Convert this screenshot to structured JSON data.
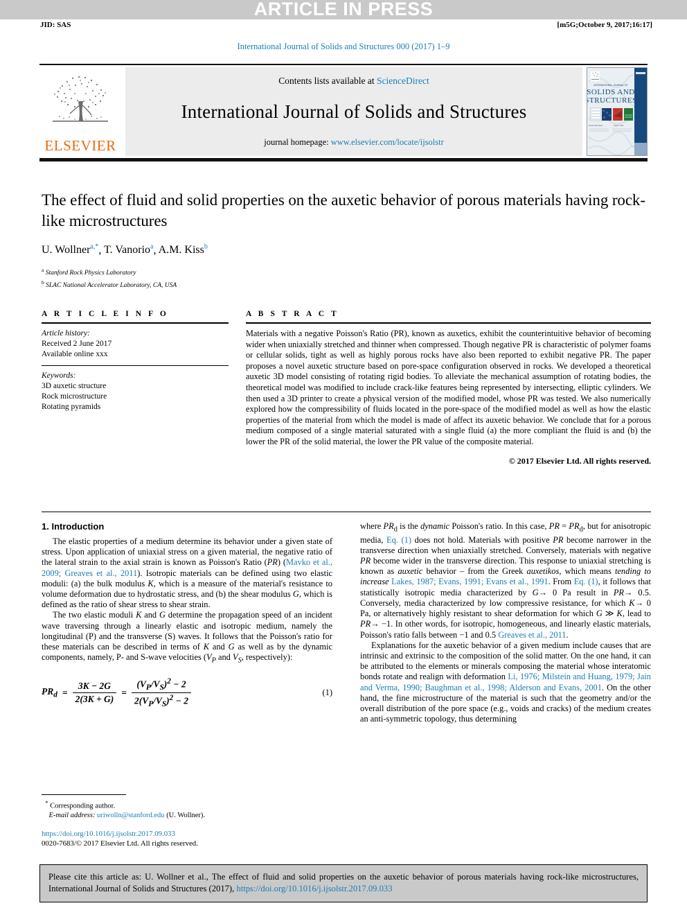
{
  "banner": {
    "press_label": "ARTICLE IN PRESS",
    "jid": "JID: SAS",
    "build_stamp": "[m5G;October 9, 2017;16:17]",
    "journal_ref": "International Journal of Solids and Structures 000 (2017) 1–9"
  },
  "masthead": {
    "contents_prefix": "Contents lists available at ",
    "contents_link": "ScienceDirect",
    "journal_title": "International Journal of Solids and Structures",
    "homepage_prefix": "journal homepage: ",
    "homepage_url": "www.elsevier.com/locate/ijsolstr",
    "publisher": "ELSEVIER",
    "cover_title_small": "INTERNATIONAL JOURNAL OF",
    "cover_title_line1": "SOLIDS AND",
    "cover_title_line2": "STRUCTURES",
    "accent_color": "#1a7db6",
    "elsevier_orange": "#eb6a09"
  },
  "article": {
    "title": "The effect of fluid and solid properties on the auxetic behavior of porous materials having rock-like microstructures",
    "authors_html": "U. Wollner, T. Vanorio, A.M. Kiss",
    "affiliation_a": "Stanford Rock Physics Laboratory",
    "affiliation_b": "SLAC National Accelerator Laboratory, CA, USA"
  },
  "info": {
    "heading": "A R T I C L E   I N F O",
    "history_label": "Article history:",
    "received": "Received 2 June 2017",
    "available": "Available online xxx",
    "keywords_label": "Keywords:",
    "keywords": [
      "3D auxetic structure",
      "Rock microstructure",
      "Rotating pyramids"
    ]
  },
  "abstract": {
    "heading": "A B S T R A C T",
    "text": "Materials with a negative Poisson's Ratio (PR), known as auxetics, exhibit the counterintuitive behavior of becoming wider when uniaxially stretched and thinner when compressed. Though negative PR is characteristic of polymer foams or cellular solids, tight as well as highly porous rocks have also been reported to exhibit negative PR. The paper proposes a novel auxetic structure based on pore-space configuration observed in rocks. We developed a theoretical auxetic 3D model consisting of rotating rigid bodies. To alleviate the mechanical assumption of rotating bodies, the theoretical model was modified to include crack-like features being represented by intersecting, elliptic cylinders. We then used a 3D printer to create a physical version of the modified model, whose PR was tested. We also numerically explored how the compressibility of fluids located in the pore-space of the modified model as well as how the elastic properties of the material from which the model is made of affect its auxetic behavior. We conclude that for a porous medium composed of a single material saturated with a single fluid (a) the more compliant the fluid is and (b) the lower the PR of the solid material, the lower the PR value of the composite material.",
    "copyright": "© 2017 Elsevier Ltd. All rights reserved."
  },
  "body": {
    "section_heading": "1. Introduction",
    "left_para_1": "The elastic properties of a medium determine its behavior under a given state of stress. Upon application of uniaxial stress on a given material, the negative ratio of the lateral strain to the axial strain is known as Poisson's Ratio (PR) (Mavko et al., 2009; Greaves et al., 2011). Isotropic materials can be defined using two elastic moduli: (a) the bulk modulus K, which is a measure of the material's resistance to volume deformation due to hydrostatic stress, and (b) the shear modulus G, which is defined as the ratio of shear stress to shear strain.",
    "left_para_2": "The two elastic moduli K and G determine the propagation speed of an incident wave traversing through a linearly elastic and isotropic medium, namely the longitudinal (P) and the transverse (S) waves. It follows that the Poisson's ratio for these materials can be described in terms of K and G as well as by the dynamic components, namely, P- and S-wave velocities (VP and VS, respectively):",
    "equation": {
      "lhs": "PR_d",
      "frac1_num": "3K − 2G",
      "frac1_den": "2(3K + G)",
      "frac2_num": "(V_P/V_S)² − 2",
      "frac2_den": "2(V_P/V_S)² − 2",
      "number": "(1)"
    },
    "right_para_1": "where PRd is the dynamic Poisson's ratio. In this case, PR = PRd, but for anisotropic media, Eq. (1) does not hold. Materials with positive PR become narrower in the transverse direction when uniaxially stretched. Conversely, materials with negative PR become wider in the transverse direction. This response to uniaxial stretching is known as auxetic behavior – from the Greek auxetikos, which means tending to increase Lakes, 1987; Evans, 1991; Evans et al., 1991. From Eq. (1), it follows that statistically isotropic media characterized by G → 0 Pa result in PR → 0.5. Conversely, media characterized by low compressive resistance, for which K → 0 Pa, or alternatively highly resistant to shear deformation for which G ≫ K, lead to PR → −1. In other words, for isotropic, homogeneous, and linearly elastic materials, Poisson's ratio falls between −1 and 0.5 Greaves et al., 2011.",
    "right_para_2": "Explanations for the auxetic behavior of a given medium include causes that are intrinsic and extrinsic to the composition of the solid matter. On the one hand, it can be attributed to the elements or minerals composing the material whose interatomic bonds rotate and realign with deformation Li, 1976; Milstein and Huang, 1979; Jain and Verma, 1990; Baughman et al., 1998; Alderson and Evans, 2001. On the other hand, the fine microstructure of the material is such that the geometry and/or the overall distribution of the pore space (e.g., voids and cracks) of the medium creates an anti-symmetric topology, thus determining"
  },
  "footnote": {
    "corresponding": "Corresponding author.",
    "email_label": "E-mail address:",
    "email": "uriwolln@stanford.edu",
    "email_owner": "(U. Wollner).",
    "doi_url": "https://doi.org/10.1016/j.ijsolstr.2017.09.033",
    "issn_line": "0020-7683/© 2017 Elsevier Ltd. All rights reserved."
  },
  "cite_footer": {
    "text_prefix": "Please cite this article as: U. Wollner et al., The effect of fluid and solid properties on the auxetic behavior of porous materials having rock-like microstructures, International Journal of Solids and Structures (2017), ",
    "doi": "https://doi.org/10.1016/j.ijsolstr.2017.09.033"
  }
}
